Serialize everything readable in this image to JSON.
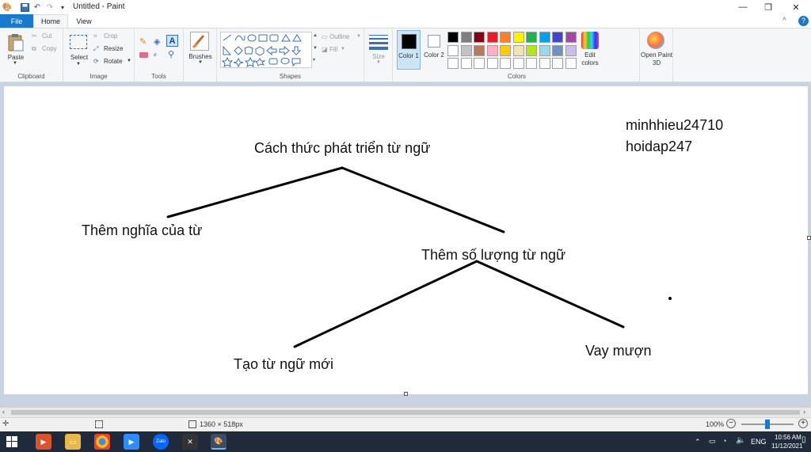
{
  "window": {
    "title": "Untitled - Paint",
    "minimize_glyph": "—",
    "maximize_glyph": "❐",
    "close_glyph": "✕",
    "help_glyph": "?",
    "collapse_glyph": "^"
  },
  "tabs": [
    "File",
    "Home",
    "View"
  ],
  "ribbon": {
    "clipboard": {
      "paste": "Paste",
      "cut": "Cut",
      "copy": "Copy",
      "group": "Clipboard"
    },
    "image": {
      "select": "Select",
      "crop": "Crop",
      "resize": "Resize",
      "rotate": "Rotate",
      "group": "Image"
    },
    "tools": {
      "group": "Tools"
    },
    "brushes": {
      "label": "Brushes"
    },
    "shapes": {
      "outline": "Outline",
      "fill": "Fill",
      "group": "Shapes"
    },
    "size": {
      "label": "Size"
    },
    "colors": {
      "color1": "Color 1",
      "color2": "Color 2",
      "edit": "Edit colors",
      "group": "Colors",
      "row1": [
        "#000000",
        "#7f7f7f",
        "#880015",
        "#ed1c24",
        "#ff7f27",
        "#fff200",
        "#22b14c",
        "#00a2e8",
        "#3f48cc",
        "#a349a4"
      ],
      "row2": [
        "#ffffff",
        "#c3c3c3",
        "#b97a57",
        "#ffaec9",
        "#ffc90e",
        "#efe4b0",
        "#b5e61d",
        "#99d9ea",
        "#7092be",
        "#c8bfe7"
      ],
      "color1_value": "#000000",
      "color2_value": "#ffffff"
    },
    "paint3d": "Open Paint 3D"
  },
  "canvas": {
    "title": "Cách thức phát triển từ ngữ",
    "left_branch": "Thêm nghĩa của từ",
    "right_branch": "Thêm số lượng từ ngữ",
    "sub_left": "Tạo từ ngữ mới",
    "sub_right": "Vay mượn",
    "author_line1": "minhhieu24710",
    "author_line2": "hoidap247"
  },
  "statusbar": {
    "dimensions": "1360 × 518px",
    "zoom": "100%",
    "zoom_level": 0.5
  },
  "taskbar": {
    "language": "ENG",
    "time": "10:56 AM",
    "date": "11/12/2021"
  }
}
